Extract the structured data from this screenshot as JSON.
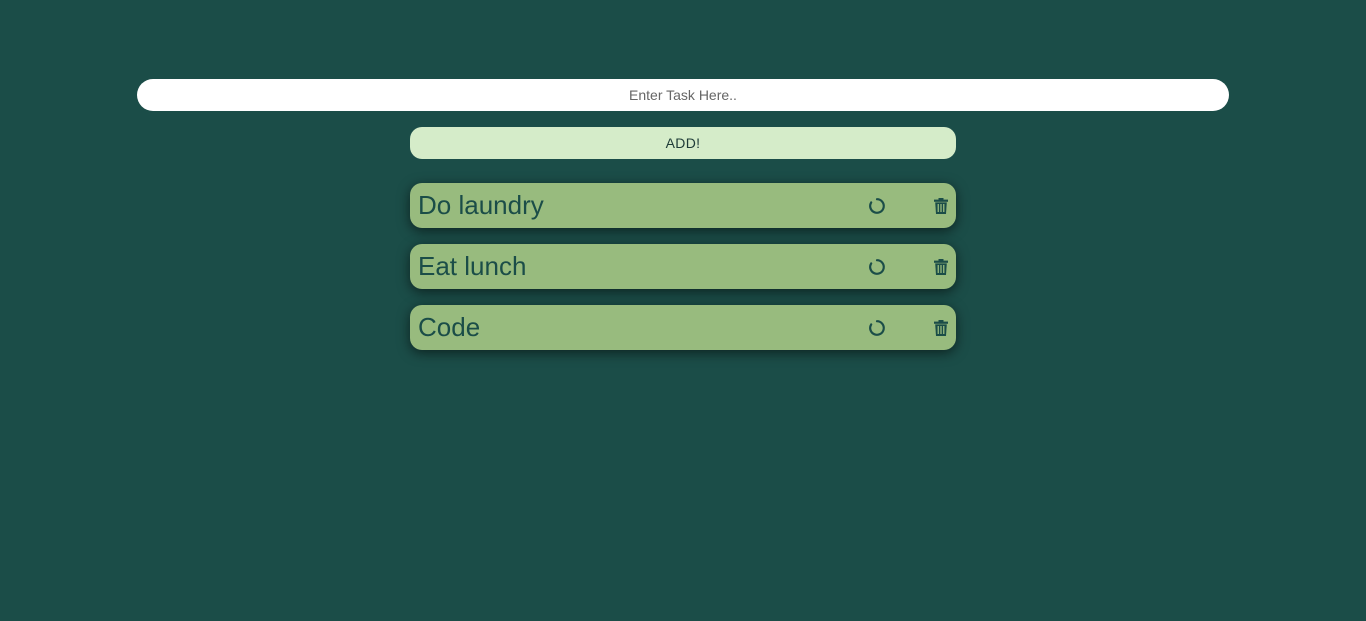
{
  "input": {
    "placeholder": "Enter Task Here..",
    "value": ""
  },
  "add_button": {
    "label": "ADD!"
  },
  "tasks": [
    {
      "text": "Do laundry",
      "status_icon": "circle-notch-icon",
      "delete_icon": "trash-icon"
    },
    {
      "text": "Eat lunch",
      "status_icon": "circle-notch-icon",
      "delete_icon": "trash-icon"
    },
    {
      "text": "Code",
      "status_icon": "circle-notch-icon",
      "delete_icon": "trash-icon"
    }
  ],
  "colors": {
    "background": "#1b4d48",
    "input_bg": "#ffffff",
    "add_button_bg": "#d5ecc9",
    "task_bg": "#98bb7e",
    "task_text": "#1b4d48"
  }
}
